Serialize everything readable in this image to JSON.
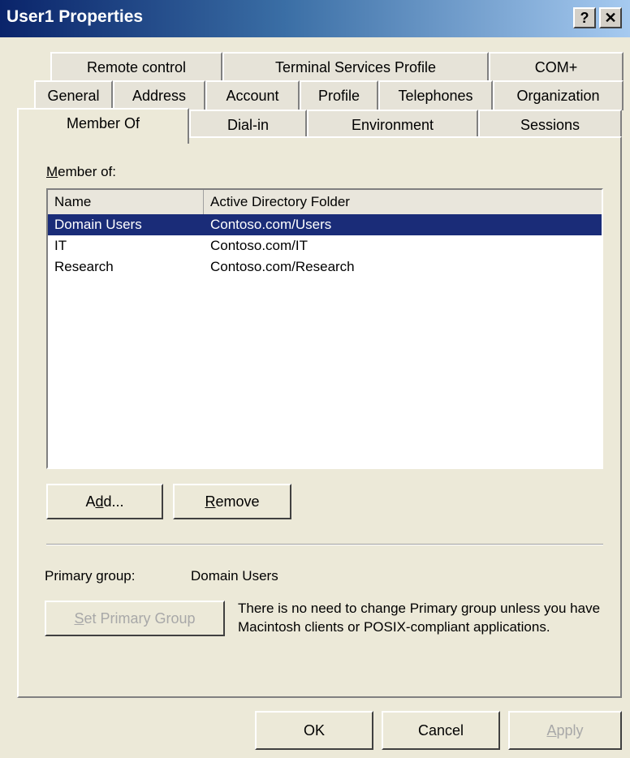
{
  "window": {
    "title": "User1 Properties",
    "help_glyph": "?",
    "close_glyph": "✕"
  },
  "tabs": {
    "row1": [
      "Remote control",
      "Terminal Services Profile",
      "COM+"
    ],
    "row2": [
      "General",
      "Address",
      "Account",
      "Profile",
      "Telephones",
      "Organization"
    ],
    "row3": [
      "Member Of",
      "Dial-in",
      "Environment",
      "Sessions"
    ],
    "active": "Member Of"
  },
  "member_of": {
    "label_u": "M",
    "label_rest": "ember of:",
    "columns": [
      "Name",
      "Active Directory Folder"
    ],
    "rows": [
      {
        "name": "Domain Users",
        "folder": "Contoso.com/Users",
        "selected": true
      },
      {
        "name": "IT",
        "folder": "Contoso.com/IT",
        "selected": false
      },
      {
        "name": "Research",
        "folder": "Contoso.com/Research",
        "selected": false
      }
    ]
  },
  "buttons": {
    "add_a": "A",
    "add_u": "d",
    "add_rest": "d...",
    "remove_u": "R",
    "remove_rest": "emove",
    "set_primary_u": "S",
    "set_primary_rest": "et Primary Group",
    "ok": "OK",
    "cancel": "Cancel",
    "apply_u": "A",
    "apply_rest": "pply"
  },
  "primary_group": {
    "label": "Primary group:",
    "value": "Domain Users",
    "note": "There is no need to change Primary group unless you have Macintosh clients or POSIX-compliant applications."
  }
}
